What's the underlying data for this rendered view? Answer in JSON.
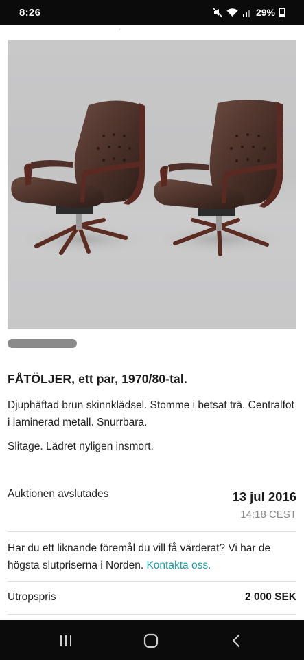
{
  "status_bar": {
    "time": "8:26",
    "battery": "29%"
  },
  "listing": {
    "title": "FÅTÖLJER, ett par, 1970/80-tal.",
    "description": "Djuphäftad brun skinnklädsel. Stomme i betsat trä. Centralfot i laminerad metall. Snurrbara.",
    "condition": "Slitage. Lädret nyligen insmort.",
    "photo_progress": 0.24
  },
  "auction": {
    "label": "Auktionen avslutades",
    "date": "13 jul 2016",
    "time": "14:18 CEST"
  },
  "valuation": {
    "text": "Har du ett liknande föremål du vill få värderat? Vi har de högsta slutpriserna i Norden. ",
    "link": "Kontakta oss."
  },
  "price": {
    "label": "Utropspris",
    "value": "2 000 SEK"
  },
  "colors": {
    "link": "#1a9aa6",
    "leather": "#4a3129",
    "wood": "#5a2a22",
    "background": "#c6c6c7"
  },
  "icons": {
    "recents": "recents-icon",
    "home": "home-icon",
    "back": "back-icon"
  }
}
